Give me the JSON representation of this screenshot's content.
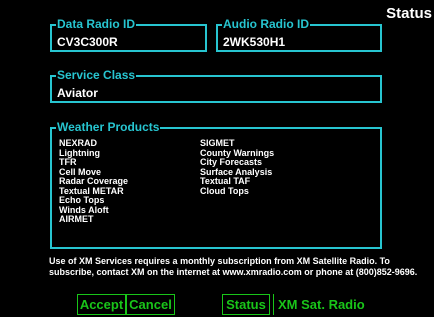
{
  "page": {
    "title": "Status"
  },
  "radio_ids": {
    "data": {
      "label": "Data Radio ID",
      "value": "CV3C300R"
    },
    "audio": {
      "label": "Audio Radio ID",
      "value": "2WK530H1"
    }
  },
  "service_class": {
    "label": "Service Class",
    "value": "Aviator"
  },
  "weather_products": {
    "label": "Weather Products",
    "column1": [
      "NEXRAD",
      "Lightning",
      "TFR",
      "Cell Move",
      "Radar Coverage",
      "Textual METAR",
      "Echo Tops",
      "Winds Aloft",
      "AIRMET"
    ],
    "column2": [
      "SIGMET",
      "County Warnings",
      "City Forecasts",
      "Surface Analysis",
      "Textual TAF",
      "Cloud Tops"
    ]
  },
  "footer_note": "Use of XM Services requires a monthly subscription from XM Satellite Radio. To subscribe, contact XM on the internet at www.xmradio.com or phone at (800)852-9696.",
  "softkeys": {
    "accept": "Accept",
    "cancel": "Cancel",
    "status": "Status",
    "xm": "XM Sat. Radio"
  },
  "colors": {
    "frame": "#27c5d0",
    "softkey": "#19c519",
    "background": "#000000",
    "text": "#ffffff"
  }
}
